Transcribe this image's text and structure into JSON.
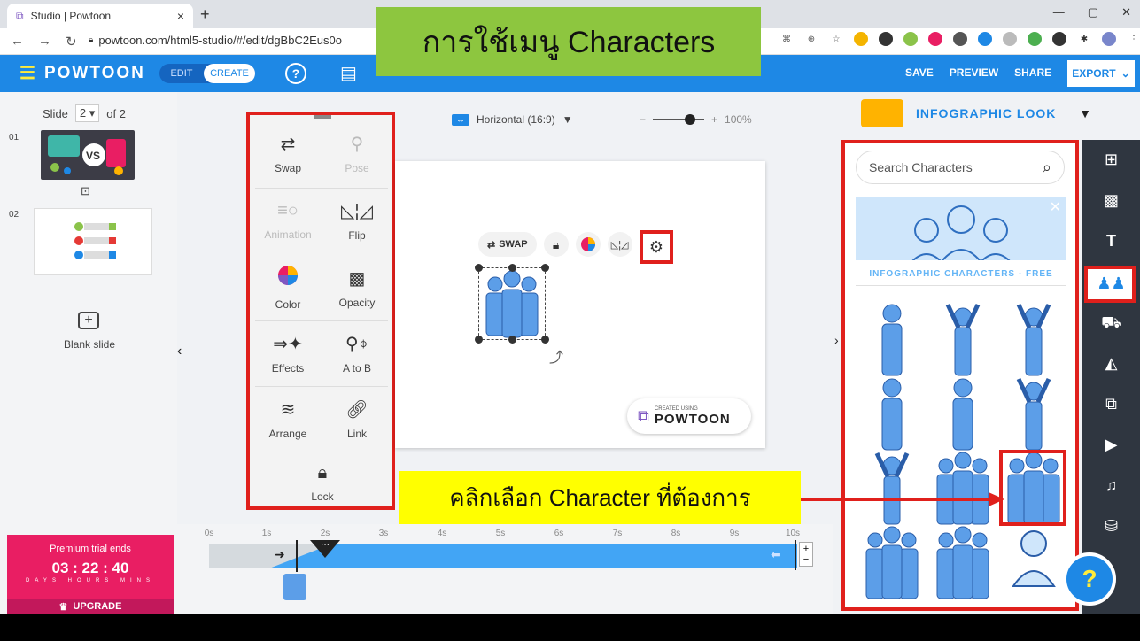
{
  "browser": {
    "tab_title": "Studio | Powtoon",
    "tab_close": "×",
    "new_tab": "+",
    "url": "powtoon.com/html5-studio/#/edit/dgBbC2Eus0o"
  },
  "overlay": {
    "title": "การใช้เมนู Characters",
    "callout": "คลิกเลือก Character   ที่ต้องการ"
  },
  "topbar": {
    "logo": "POWTOON",
    "mode_edit": "EDIT",
    "mode_create": "CREATE",
    "help": "?",
    "save": "SAVE",
    "preview": "PREVIEW",
    "share": "SHARE",
    "export": "EXPORT"
  },
  "slides": {
    "label": "Slide",
    "current": "2",
    "total": "of 2",
    "num1": "01",
    "num2": "02",
    "blank_label": "Blank slide"
  },
  "trial": {
    "label": "Premium trial ends",
    "timer": "03 : 22 : 40",
    "units": "DAYS HOURS MINS",
    "upgrade": "UPGRADE"
  },
  "menu": {
    "swap": "Swap",
    "pose": "Pose",
    "animation": "Animation",
    "flip": "Flip",
    "color": "Color",
    "opacity": "Opacity",
    "effects": "Effects",
    "a_to_b": "A to B",
    "arrange": "Arrange",
    "link": "Link",
    "lock": "Lock"
  },
  "canvas": {
    "ratio": "Horizontal (16:9)",
    "zoom": "100%",
    "swap_btn": "SWAP",
    "created_using": "CREATED USING",
    "created_brand": "POWTOON"
  },
  "timeline": {
    "ticks": [
      "0s",
      "1s",
      "2s",
      "3s",
      "4s",
      "5s",
      "6s",
      "7s",
      "8s",
      "9s",
      "10s"
    ]
  },
  "library": {
    "name": "INFOGRAPHIC LOOK",
    "search_placeholder": "Search Characters",
    "category": "INFOGRAPHIC CHARACTERS - FREE"
  },
  "colors": {
    "brand_blue": "#1e88e5",
    "highlight_red": "#e0201c",
    "title_green": "#8dc63f",
    "callout_yellow": "#ffff00",
    "character_blue": "#5c9ee8"
  }
}
